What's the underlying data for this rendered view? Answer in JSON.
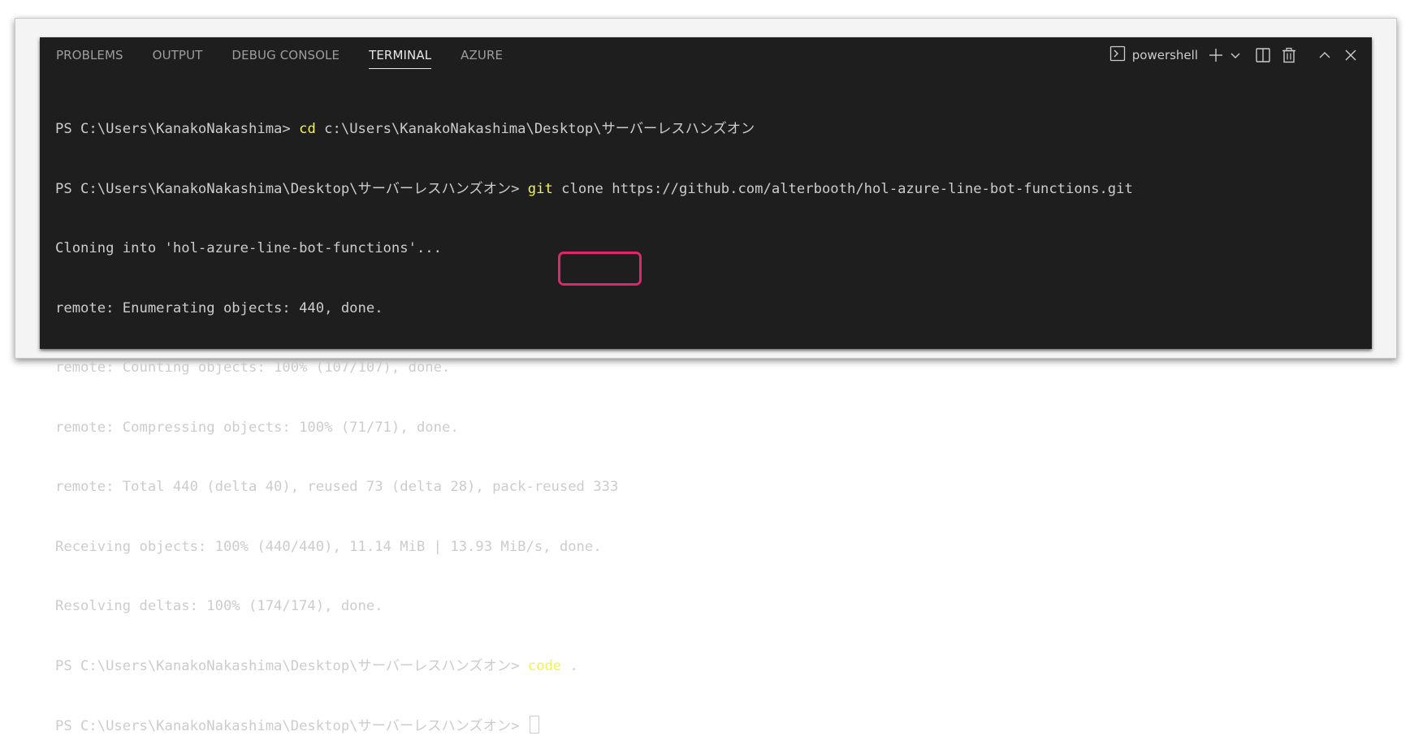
{
  "panel": {
    "tabs": [
      {
        "label": "PROBLEMS",
        "active": false
      },
      {
        "label": "OUTPUT",
        "active": false
      },
      {
        "label": "DEBUG CONSOLE",
        "active": false
      },
      {
        "label": "TERMINAL",
        "active": true
      },
      {
        "label": "AZURE",
        "active": false
      }
    ],
    "shell_label": "powershell",
    "icons": {
      "terminal": "terminal-icon",
      "add": "plus-icon",
      "dropdown": "chevron-down-icon",
      "split": "split-icon",
      "kill": "trash-icon",
      "maximize": "chevron-up-icon",
      "close": "close-icon"
    }
  },
  "terminal": {
    "lines": [
      {
        "prompt": "PS C:\\Users\\KanakoNakashima> ",
        "cmd": "cd",
        "rest": " c:\\Users\\KanakoNakashima\\Desktop\\サーバーレスハンズオン"
      },
      {
        "prompt": "PS C:\\Users\\KanakoNakashima\\Desktop\\サーバーレスハンズオン> ",
        "cmd": "git",
        "rest": " clone https://github.com/alterbooth/hol-azure-line-bot-functions.git"
      },
      {
        "prompt": "",
        "cmd": "",
        "rest": "Cloning into 'hol-azure-line-bot-functions'..."
      },
      {
        "prompt": "",
        "cmd": "",
        "rest": "remote: Enumerating objects: 440, done."
      },
      {
        "prompt": "",
        "cmd": "",
        "rest": "remote: Counting objects: 100% (107/107), done."
      },
      {
        "prompt": "",
        "cmd": "",
        "rest": "remote: Compressing objects: 100% (71/71), done."
      },
      {
        "prompt": "",
        "cmd": "",
        "rest": "remote: Total 440 (delta 40), reused 73 (delta 28), pack-reused 333"
      },
      {
        "prompt": "",
        "cmd": "",
        "rest": "Receiving objects: 100% (440/440), 11.14 MiB | 13.93 MiB/s, done."
      },
      {
        "prompt": "",
        "cmd": "",
        "rest": "Resolving deltas: 100% (174/174), done."
      },
      {
        "prompt": "PS C:\\Users\\KanakoNakashima\\Desktop\\サーバーレスハンズオン> ",
        "cmd": "code",
        "rest": " ."
      },
      {
        "prompt": "PS C:\\Users\\KanakoNakashima\\Desktop\\サーバーレスハンズオン> ",
        "cmd": "",
        "rest": ""
      }
    ]
  },
  "colors": {
    "background": "#1e1e1e",
    "text": "#cccccc",
    "command": "#f1f15a",
    "highlight_box": "#e0266a"
  }
}
